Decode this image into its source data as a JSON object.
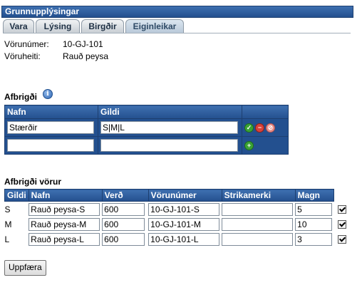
{
  "panel": {
    "title": "Grunnupplýsingar"
  },
  "tabs": [
    "Vara",
    "Lýsing",
    "Birgðir",
    "Eiginleikar"
  ],
  "active_tab": "Eiginleikar",
  "product": {
    "number_label": "Vörunúmer:",
    "number_value": "10-GJ-101",
    "name_label": "Vöruheiti:",
    "name_value": "Rauð peysa"
  },
  "attributes": {
    "title": "Afbrigði",
    "help_icon": "info-icon",
    "headers": [
      "Nafn",
      "Gildi",
      ""
    ],
    "row": {
      "name": "Stærðir",
      "value": "S|M|L"
    },
    "new_row": {
      "name": "",
      "value": ""
    }
  },
  "variants": {
    "title": "Afbrigði vörur",
    "headers": [
      "Gildi",
      "Nafn",
      "Verð",
      "Vörunúmer",
      "Strikamerki",
      "Magn"
    ],
    "rows": [
      {
        "gildi": "S",
        "nafn": "Rauð peysa-S",
        "verd": "600",
        "vorunumer": "10-GJ-101-S",
        "strikamerki": "",
        "magn": "5",
        "checked": true
      },
      {
        "gildi": "M",
        "nafn": "Rauð peysa-M",
        "verd": "600",
        "vorunumer": "10-GJ-101-M",
        "strikamerki": "",
        "magn": "10",
        "checked": true
      },
      {
        "gildi": "L",
        "nafn": "Rauð peysa-L",
        "verd": "600",
        "vorunumer": "10-GJ-101-L",
        "strikamerki": "",
        "magn": "3",
        "checked": true
      }
    ]
  },
  "update_button": "Uppfæra",
  "colors": {
    "header_blue": "#24508f",
    "ok_green": "#3aa235",
    "delete_red": "#d8423a"
  }
}
